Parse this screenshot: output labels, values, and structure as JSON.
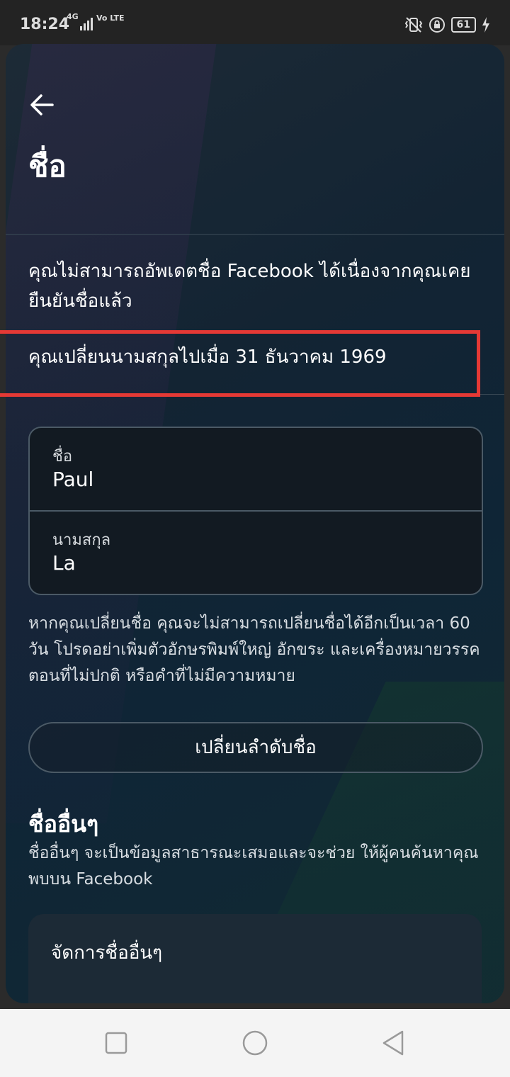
{
  "status_bar": {
    "time": "18:24",
    "network": "4G",
    "volte": "Vo LTE",
    "battery": "61"
  },
  "page": {
    "title": "ชื่อ",
    "notice": "คุณไม่สามารถอัพเดตชื่อ Facebook ได้เนื่องจากคุณเคยยืนยันชื่อแล้ว",
    "changed_line": "คุณเปลี่ยนนามสกุลไปเมื่อ 31 ธันวาคม  1969"
  },
  "name_fields": {
    "first_label": "ชื่อ",
    "first_value": "Paul",
    "last_label": "นามสกุล",
    "last_value": "La"
  },
  "help_text": "หากคุณเปลี่ยนชื่อ คุณจะไม่สามารถเปลี่ยนชื่อได้อีกเป็นเวลา 60 วัน โปรดอย่าเพิ่มตัวอักษรพิมพ์ใหญ่ อักขระ และเครื่องหมายวรรคตอนที่ไม่ปกติ หรือคำที่ไม่มีความหมาย",
  "order_button": "เปลี่ยนลำดับชื่อ",
  "other_names": {
    "title": "ชื่ออื่นๆ",
    "description": "ชื่ออื่นๆ จะเป็นข้อมูลสาธารณะเสมอและจะช่วย ให้ผู้คนค้นหาคุณพบบน Facebook",
    "manage_label": "จัดการชื่ออื่นๆ"
  },
  "colors": {
    "highlight": "#e53935",
    "sheet_background": "#132433"
  },
  "icons": {
    "back": "arrow-left",
    "nav_recent": "square",
    "nav_home": "circle",
    "nav_back": "triangle-left"
  }
}
